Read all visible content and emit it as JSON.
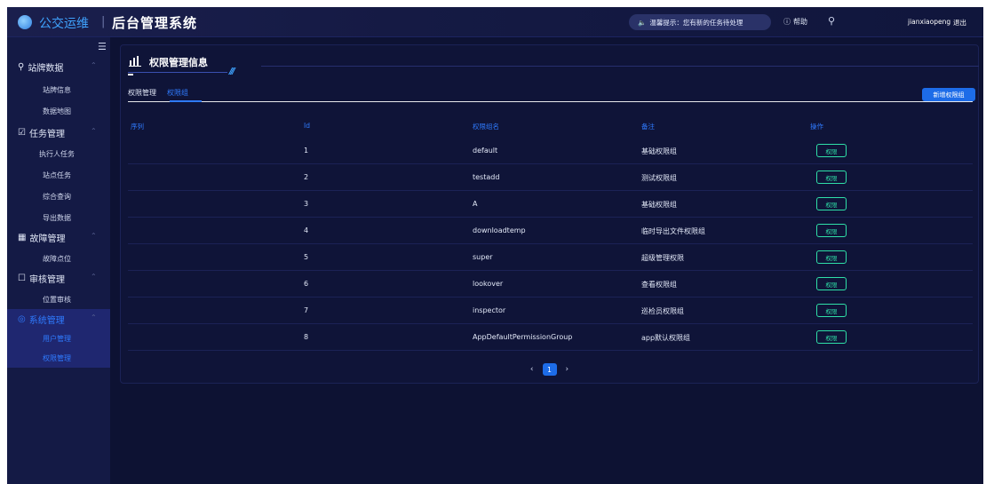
{
  "header": {
    "app_name": "公交运维",
    "divider": "|",
    "system_title": "后台管理系统",
    "notice_icon": "speaker-icon",
    "notice_text": "温馨提示：您有新的任务待处理",
    "help_label": "帮助",
    "user_name": "jianxiaopeng",
    "logout_label": "退出"
  },
  "sidebar": {
    "groups": [
      {
        "icon": "pin-icon",
        "label": "站牌数据",
        "items": [
          "站牌信息",
          "数据地图"
        ]
      },
      {
        "icon": "task-icon",
        "label": "任务管理",
        "items": [
          "执行人任务",
          "站点任务",
          "综合查询",
          "导出数据"
        ]
      },
      {
        "icon": "fault-icon",
        "label": "故障管理",
        "items": [
          "故障点位"
        ]
      },
      {
        "icon": "audit-icon",
        "label": "审核管理",
        "items": [
          "位置审核"
        ]
      },
      {
        "icon": "settings-icon",
        "label": "系统管理",
        "items": [
          "用户管理",
          "权限管理"
        ]
      }
    ]
  },
  "panel": {
    "title": "权限管理信息",
    "stripes": "///",
    "tabs": [
      "权限管理",
      "权限组"
    ],
    "active_tab": "权限组",
    "add_button": "新增权限组"
  },
  "table": {
    "columns": [
      "序列",
      "Id",
      "权限组名",
      "备注",
      "操作"
    ],
    "rows": [
      {
        "id": "1",
        "name": "default",
        "note": "基础权限组",
        "action": "权限"
      },
      {
        "id": "2",
        "name": "testadd",
        "note": "测试权限组",
        "action": "权限"
      },
      {
        "id": "3",
        "name": "A",
        "note": "基础权限组",
        "action": "权限"
      },
      {
        "id": "4",
        "name": "downloadtemp",
        "note": "临时导出文件权限组",
        "action": "权限"
      },
      {
        "id": "5",
        "name": "super",
        "note": "超级管理权限",
        "action": "权限"
      },
      {
        "id": "6",
        "name": "lookover",
        "note": "查看权限组",
        "action": "权限"
      },
      {
        "id": "7",
        "name": "inspector",
        "note": "巡检员权限组",
        "action": "权限"
      },
      {
        "id": "8",
        "name": "AppDefaultPermissionGroup",
        "note": "app默认权限组",
        "action": "权限"
      }
    ]
  },
  "pager": {
    "prev": "‹",
    "current": "1",
    "next": "›"
  },
  "colors": {
    "accent": "#2f7bff",
    "action": "#2fe0a8",
    "background": "#0d1233"
  }
}
